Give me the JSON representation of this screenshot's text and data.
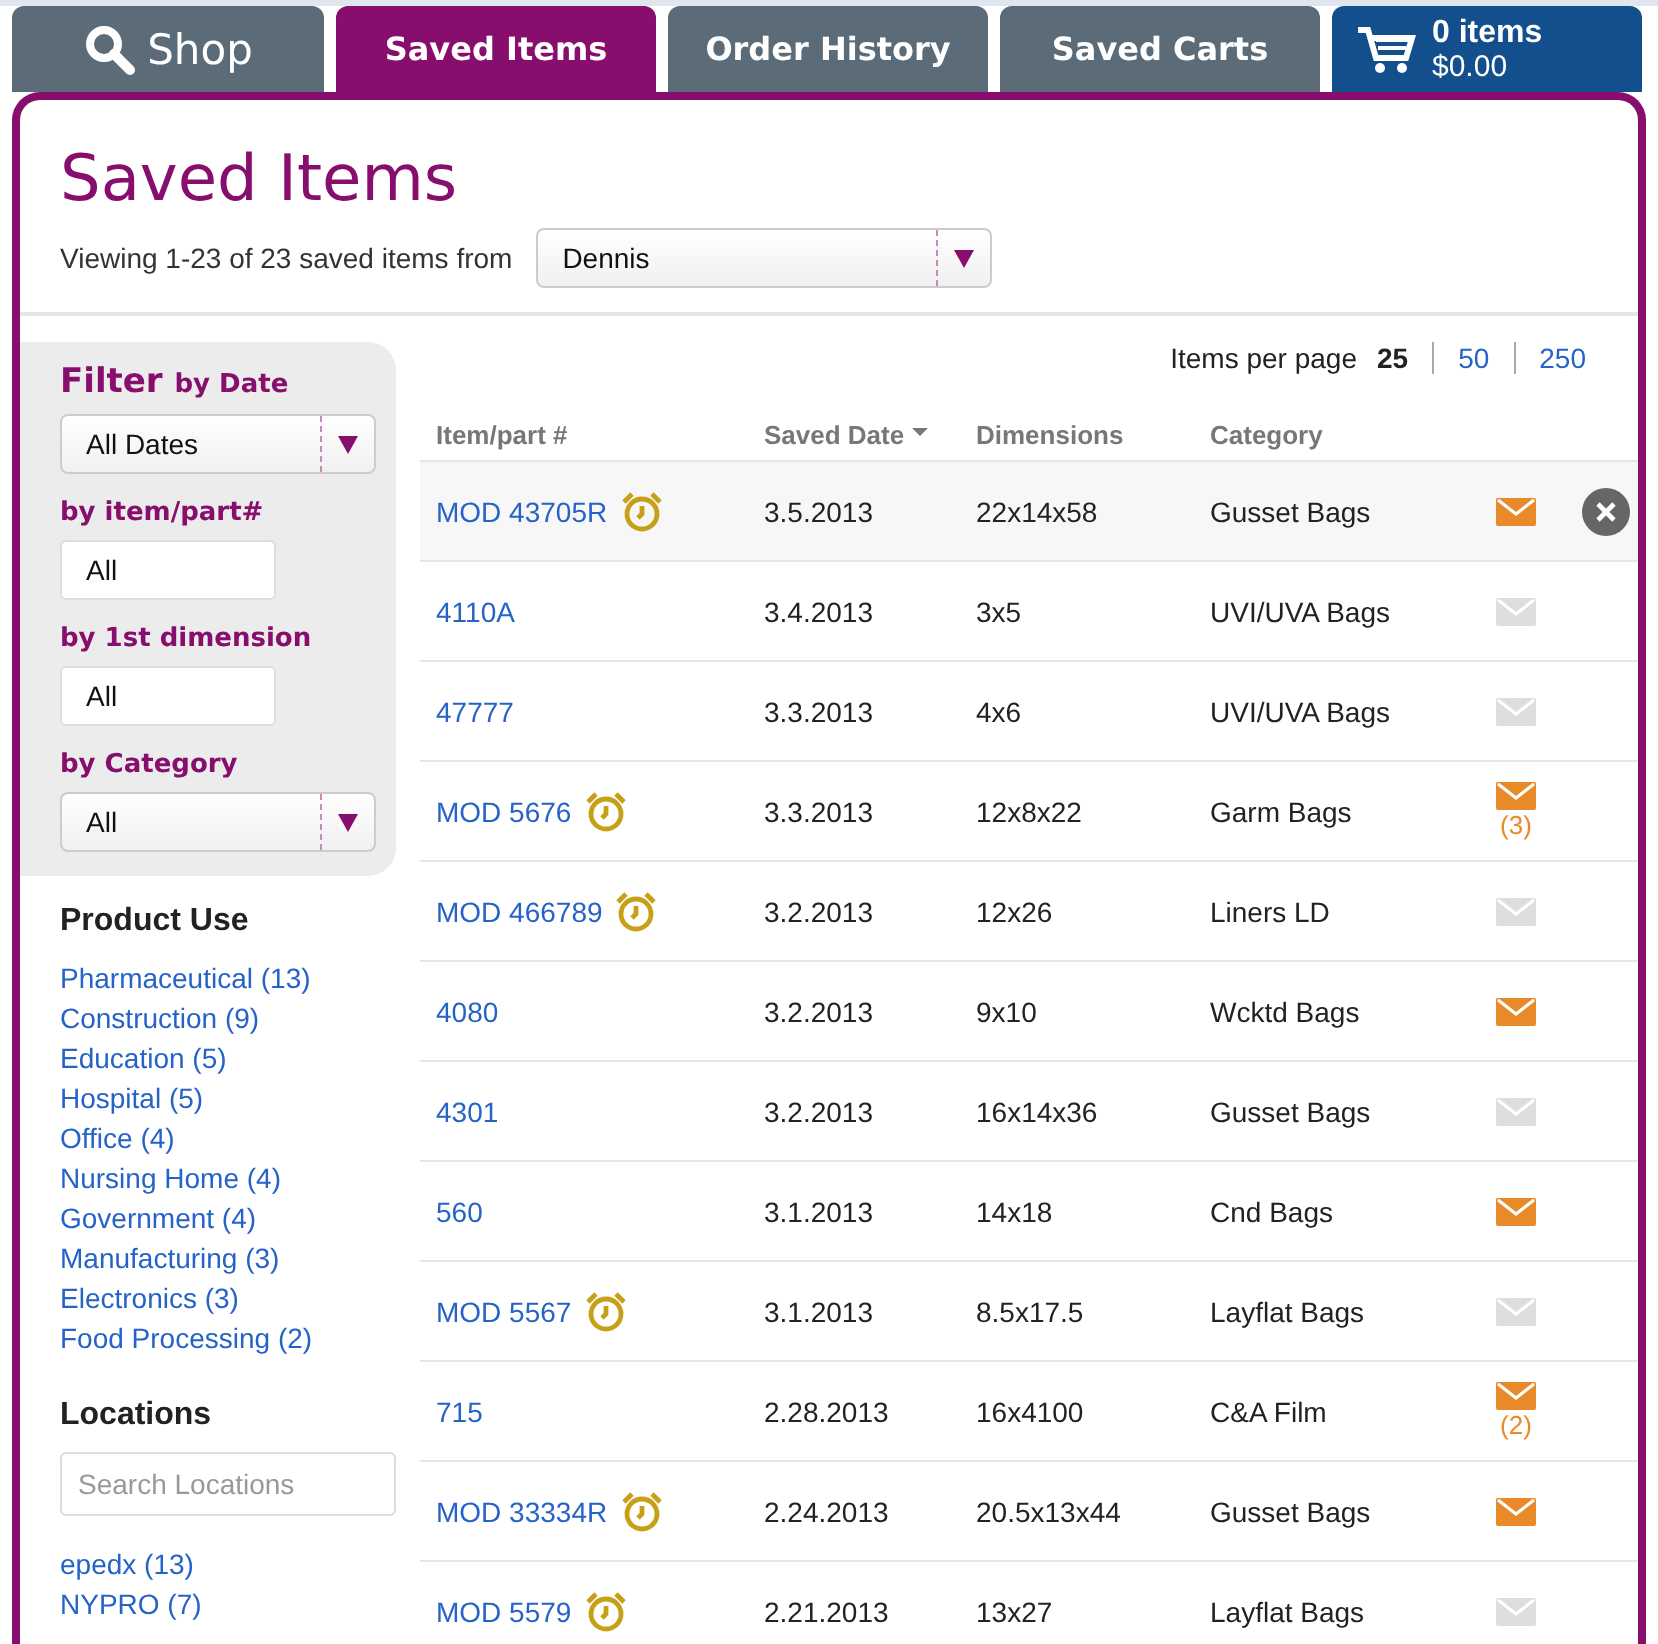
{
  "tabs": [
    {
      "kind": "search",
      "label": "Shop",
      "selected": false
    },
    {
      "kind": "text",
      "label": "Saved Items",
      "selected": true
    },
    {
      "kind": "text",
      "label": "Order History",
      "selected": false
    },
    {
      "kind": "text",
      "label": "Saved Carts",
      "selected": false
    }
  ],
  "cart": {
    "items": "0 items",
    "total": "$0.00"
  },
  "page": {
    "title": "Saved Items",
    "viewing": "Viewing 1-23 of 23 saved items from",
    "owner_select": {
      "value": "Dennis"
    }
  },
  "filters": {
    "heading": "Filter",
    "date_label": "by Date",
    "date_select": {
      "value": "All Dates"
    },
    "part_label": "by item/part#",
    "part_field": {
      "value": "All"
    },
    "dimension_label": "by 1st dimension",
    "dimension_field": {
      "value": "All"
    },
    "category_label": "by Category",
    "category_select": {
      "value": "All"
    }
  },
  "product_use": {
    "heading": "Product Use",
    "items": [
      "Pharmaceutical (13)",
      "Construction (9)",
      "Education (5)",
      "Hospital (5)",
      "Office (4)",
      "Nursing Home (4)",
      "Government (4)",
      "Manufacturing (3)",
      "Electronics (3)",
      "Food Processing (2)"
    ]
  },
  "locations": {
    "heading": "Locations",
    "search": {
      "placeholder": "Search Locations"
    },
    "items": [
      "epedx (13)",
      "NYPRO (7)"
    ]
  },
  "per_page": {
    "label": "Items per page",
    "options": [
      {
        "label": "25",
        "selected": true
      },
      {
        "label": "50",
        "selected": false
      },
      {
        "label": "250",
        "selected": false
      }
    ]
  },
  "table": {
    "columns": [
      {
        "label": "Item/part #",
        "sorted": false
      },
      {
        "label": "Saved Date",
        "sorted": true
      },
      {
        "label": "Dimensions",
        "sorted": false
      },
      {
        "label": "Category",
        "sorted": false
      }
    ],
    "rows": [
      {
        "item": "MOD 43705R",
        "alarm": true,
        "date": "3.5.2013",
        "dimensions": "22x14x58",
        "category": "Gusset Bags",
        "mail": true,
        "highlighted": true
      },
      {
        "item": "4110A",
        "alarm": false,
        "date": "3.4.2013",
        "dimensions": "3x5",
        "category": "UVI/UVA Bags",
        "mail": false,
        "highlighted": false
      },
      {
        "item": "47777",
        "alarm": false,
        "date": "3.3.2013",
        "dimensions": "4x6",
        "category": "UVI/UVA Bags",
        "mail": false,
        "highlighted": false
      },
      {
        "item": "MOD 5676",
        "alarm": true,
        "date": "3.3.2013",
        "dimensions": "12x8x22",
        "category": "Garm Bags",
        "mail": true,
        "mail_count": "(3)",
        "highlighted": false
      },
      {
        "item": "MOD 466789",
        "alarm": true,
        "date": "3.2.2013",
        "dimensions": "12x26",
        "category": "Liners LD",
        "mail": false,
        "highlighted": false
      },
      {
        "item": "4080",
        "alarm": false,
        "date": "3.2.2013",
        "dimensions": "9x10",
        "category": "Wcktd Bags",
        "mail": true,
        "highlighted": false
      },
      {
        "item": "4301",
        "alarm": false,
        "date": "3.2.2013",
        "dimensions": "16x14x36",
        "category": "Gusset Bags",
        "mail": false,
        "highlighted": false
      },
      {
        "item": "560",
        "alarm": false,
        "date": "3.1.2013",
        "dimensions": "14x18",
        "category": "Cnd Bags",
        "mail": true,
        "highlighted": false
      },
      {
        "item": "MOD 5567",
        "alarm": true,
        "date": "3.1.2013",
        "dimensions": "8.5x17.5",
        "category": "Layflat Bags",
        "mail": false,
        "highlighted": false
      },
      {
        "item": "715",
        "alarm": false,
        "date": "2.28.2013",
        "dimensions": "16x4100",
        "category": "C&A Film",
        "mail": true,
        "mail_count": "(2)",
        "highlighted": false
      },
      {
        "item": "MOD 33334R",
        "alarm": true,
        "date": "2.24.2013",
        "dimensions": "20.5x13x44",
        "category": "Gusset Bags",
        "mail": true,
        "highlighted": false
      },
      {
        "item": "MOD 5579",
        "alarm": true,
        "date": "2.21.2013",
        "dimensions": "13x27",
        "category": "Layflat Bags",
        "mail": false,
        "highlighted": false
      }
    ]
  }
}
